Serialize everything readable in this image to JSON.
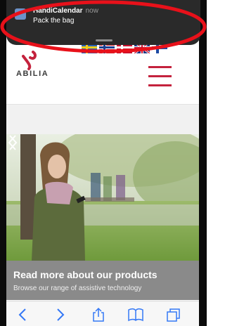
{
  "notification": {
    "app_name": "HandiCalendar",
    "time": "now",
    "message": "Pack the bag"
  },
  "header": {
    "logo_text": "ABILIA",
    "flags": [
      "sweden-flag",
      "norway-flag",
      "denmark-flag",
      "uk-flag",
      "finland-flag"
    ]
  },
  "hero": {
    "title": "Read more about our products",
    "subtitle": "Browse our range of assistive technology"
  },
  "toolbar": {
    "buttons": [
      "back",
      "forward",
      "share",
      "bookmarks",
      "tabs"
    ]
  },
  "colors": {
    "brand_red": "#c4223d",
    "annotation_red": "#e8111a",
    "toolbar_blue": "#3478f6",
    "notification_bg": "#2a2a2a"
  }
}
